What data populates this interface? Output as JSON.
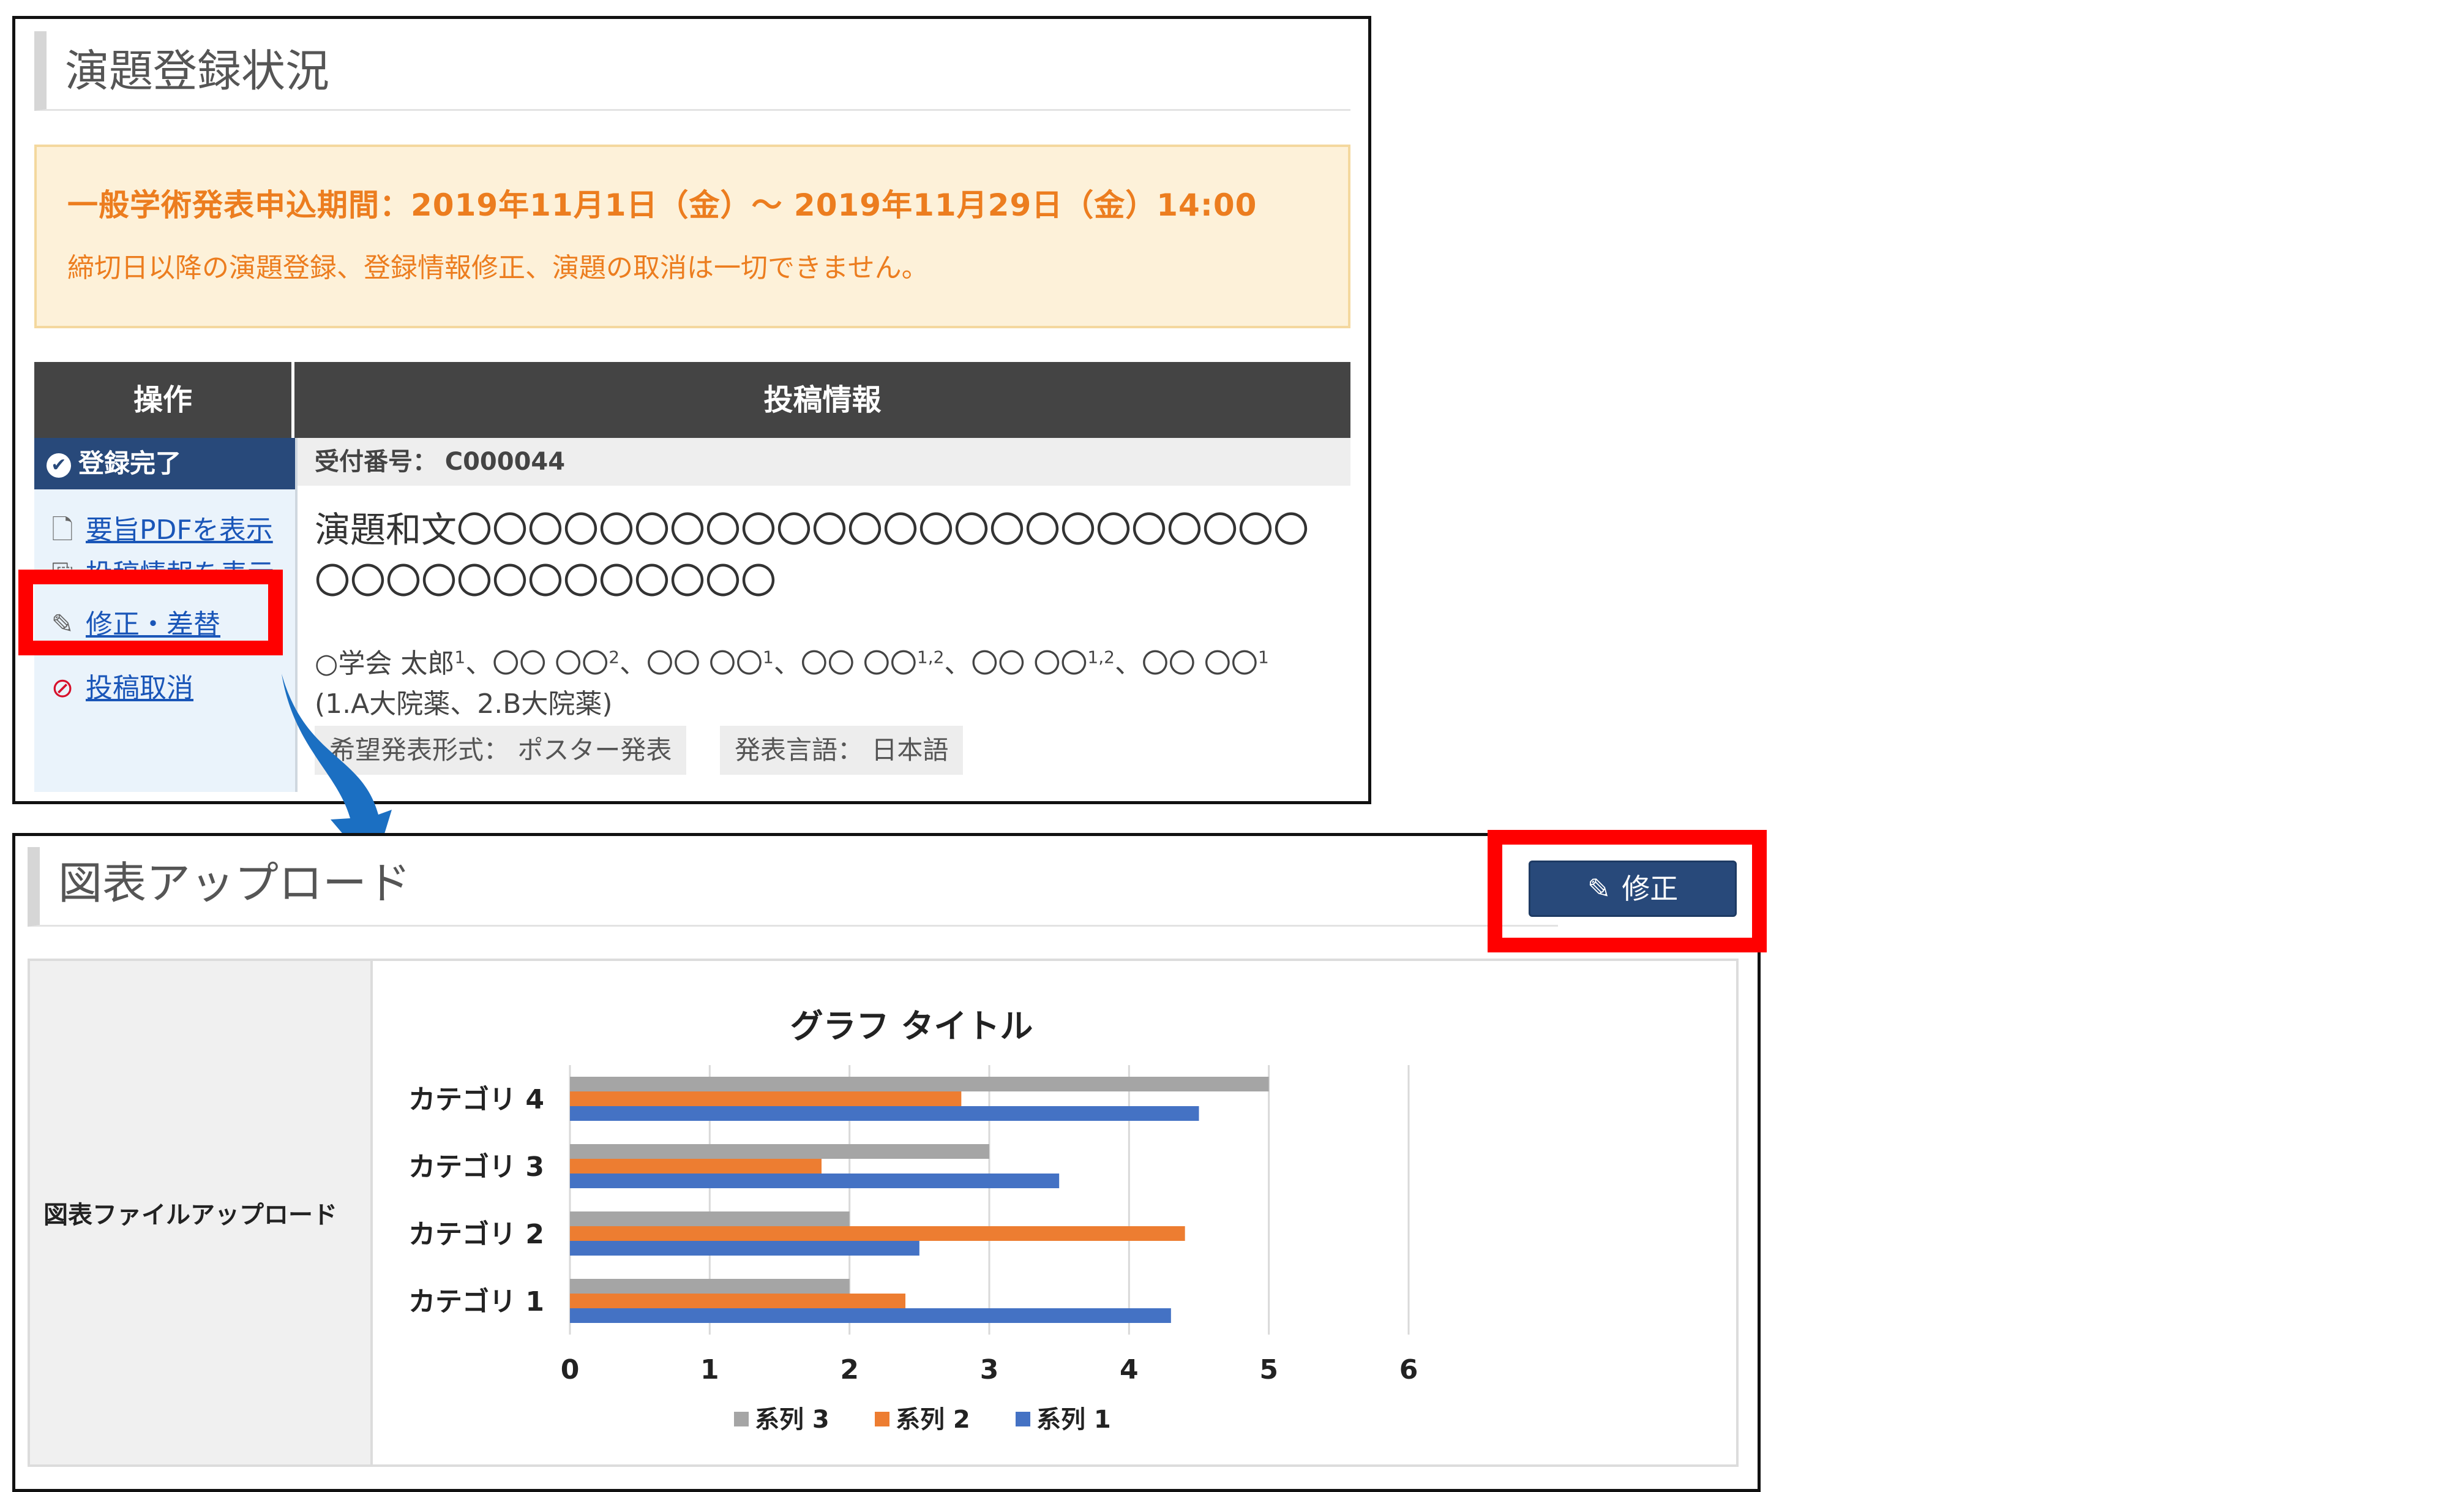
{
  "top": {
    "section_title": "演題登録状況",
    "notice": {
      "period": "一般学術発表申込期間：2019年11月1日（金）～ 2019年11月29日（金）14:00",
      "warning": "締切日以降の演題登録、登録情報修正、演題の取消は一切できません。"
    },
    "table": {
      "header_ops": "操作",
      "header_info": "投稿情報",
      "status": "登録完了",
      "ops": {
        "pdf": "要旨PDFを表示",
        "info": "投稿情報を表示",
        "edit": "修正・差替",
        "cancel": "投稿取消"
      },
      "receipt_label": "受付番号：",
      "receipt_no": "C000044",
      "title": "演題和文〇〇〇〇〇〇〇〇〇〇〇〇〇〇〇〇〇〇〇〇〇〇〇〇〇〇〇〇〇〇〇〇〇〇〇〇〇",
      "authors": [
        {
          "name": "○学会 太郎",
          "sup": "1"
        },
        {
          "name": "〇〇 〇〇",
          "sup": "2"
        },
        {
          "name": "〇〇 〇〇",
          "sup": "1"
        },
        {
          "name": "〇〇 〇〇",
          "sup": "1,2"
        },
        {
          "name": "〇〇 〇〇",
          "sup": "1,2"
        },
        {
          "name": "〇〇 〇〇",
          "sup": "1"
        }
      ],
      "affiliations": "(1.A大院薬、2.B大院薬)",
      "format_tag": "希望発表形式： ポスター発表",
      "lang_tag": "発表言語： 日本語"
    }
  },
  "bottom": {
    "section_title": "図表アップロード",
    "edit_button": "修正",
    "upload_label": "図表ファイルアップロード"
  },
  "chart_data": {
    "type": "bar",
    "orientation": "horizontal",
    "title": "グラフ タイトル",
    "categories": [
      "カテゴリ 1",
      "カテゴリ 2",
      "カテゴリ 3",
      "カテゴリ 4"
    ],
    "series": [
      {
        "name": "系列 1",
        "color": "#4472c4",
        "values": [
          4.3,
          2.5,
          3.5,
          4.5
        ]
      },
      {
        "name": "系列 2",
        "color": "#ed7d31",
        "values": [
          2.4,
          4.4,
          1.8,
          2.8
        ]
      },
      {
        "name": "系列 3",
        "color": "#a5a5a5",
        "values": [
          2,
          2,
          3,
          5
        ]
      }
    ],
    "xlim": [
      0,
      6
    ],
    "xticks": [
      0,
      1,
      2,
      3,
      4,
      5,
      6
    ],
    "grid": true,
    "legend": "bottom",
    "legend_order": [
      "系列 3",
      "系列 2",
      "系列 1"
    ]
  },
  "colors": {
    "accent_navy": "#28497a",
    "highlight_red": "#ff0000",
    "notice_orange": "#ec7d1f",
    "arrow_blue": "#1b6fc2"
  }
}
